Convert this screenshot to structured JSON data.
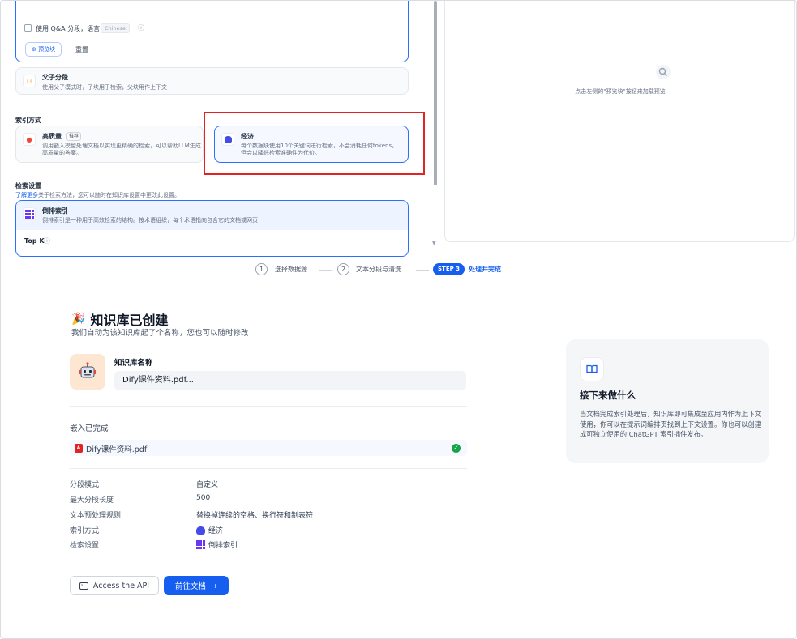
{
  "chunk_settings": {
    "qa_checkbox_label": "使用 Q&A 分段，语言",
    "qa_language": "Chinese",
    "preview_button": "预览块",
    "reset_button": "重置"
  },
  "parent_child": {
    "title": "父子分段",
    "desc": "使用父子模式时，子块用于检索，父块用作上下文"
  },
  "index_method": {
    "section_title": "索引方式",
    "high_quality": {
      "title": "高质量",
      "badge": "推荐",
      "desc": "调用嵌入模型处理文档以实现更精确的检索，可以帮助LLM生成高质量的答案。"
    },
    "economy": {
      "title": "经济",
      "desc": "每个数据块使用10个关键词进行检索，不会消耗任何tokens，但会以降低检索准确性为代价。"
    }
  },
  "retrieval": {
    "section_title": "检索设置",
    "link_text": "了解更多",
    "hint": "关于检索方法，您可以随时在知识库设置中更改此设置。",
    "inverted": {
      "title": "倒排索引",
      "desc": "倒排索引是一种用于高效检索的结构。按术语组织，每个术语指向包含它的文档或网页"
    },
    "topk_label": "Top K"
  },
  "preview_panel": {
    "hint": "点击左侧的\"预览块\"按钮来加载预览"
  },
  "steps": [
    {
      "num": "1",
      "label": "选择数据源"
    },
    {
      "num": "2",
      "label": "文本分段与清洗"
    },
    {
      "num": "STEP 3",
      "label": "处理并完成"
    }
  ],
  "main": {
    "title": "知识库已创建",
    "subtitle": "我们自动为该知识库起了个名称，您也可以随时修改",
    "name_label": "知识库名称",
    "name_value": "Dify课件资料.pdf...",
    "embed_title": "嵌入已完成",
    "file_name": "Dify课件资料.pdf",
    "file_icon_text": "A",
    "details": [
      {
        "key": "分段模式",
        "value": "自定义"
      },
      {
        "key": "最大分段长度",
        "value": "500"
      },
      {
        "key": "文本预处理规则",
        "value": "替换掉连续的空格、换行符和制表符"
      },
      {
        "key": "索引方式",
        "value": "经济"
      },
      {
        "key": "检索设置",
        "value": "倒排索引"
      }
    ],
    "api_button": "Access the API",
    "doc_button": "前往文档"
  },
  "next_card": {
    "title": "接下来做什么",
    "body": "当文档完成索引处理后，知识库即可集成至应用内作为上下文使用，你可以在提示词编排页找到上下文设置。你也可以创建成可独立使用的 ChatGPT 索引插件发布。"
  },
  "colors": {
    "primary": "#155eef",
    "highlight_box": "#e02424",
    "success": "#16a34a"
  },
  "icons": [
    "party-popper-icon",
    "robot-avatar-icon",
    "pdf-file-icon",
    "check-circle-icon",
    "book-open-icon",
    "terminal-icon",
    "arrow-right-icon",
    "search-preview-icon"
  ]
}
